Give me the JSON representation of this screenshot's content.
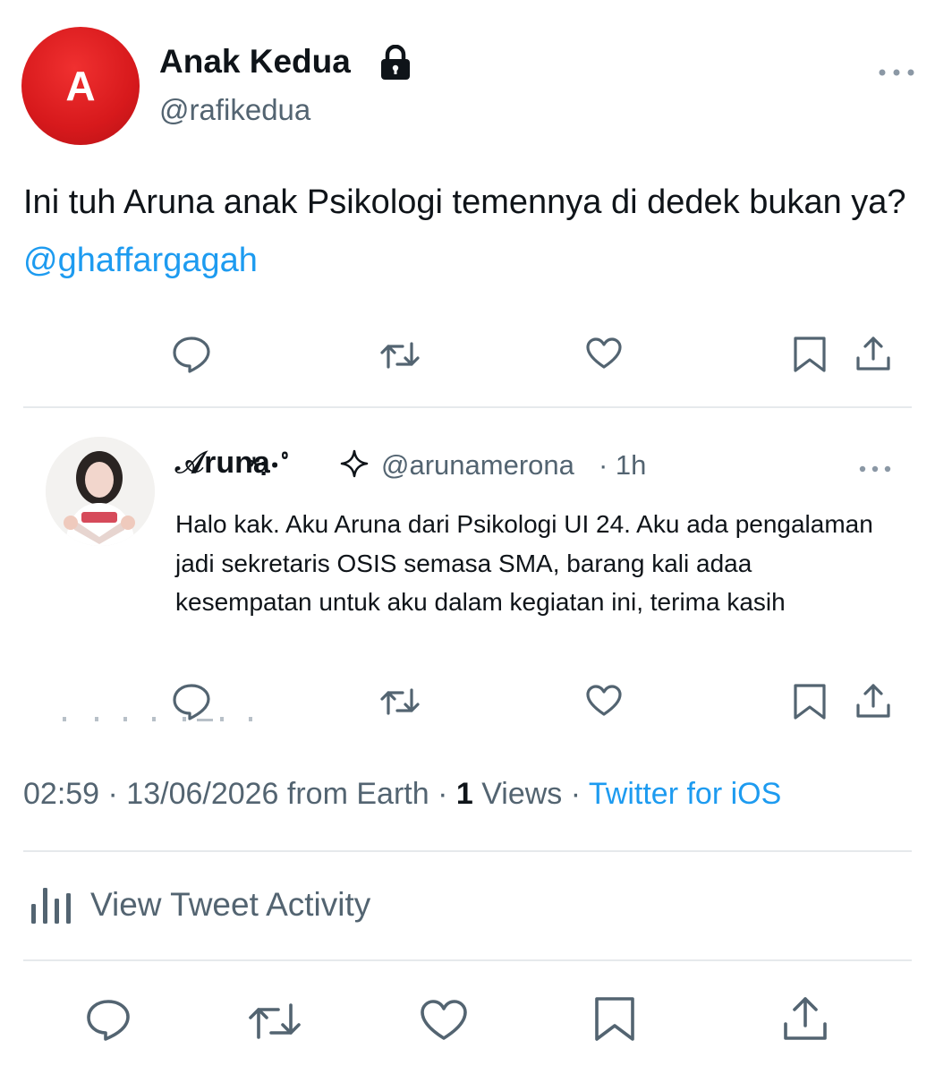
{
  "author": {
    "avatar_letter": "A",
    "avatar_color": "#d7191c",
    "display_name": "Anak Kedua",
    "handle": "@rafikedua",
    "protected_icon": "lock-icon"
  },
  "tweet": {
    "text_main": "Ini tuh Aruna anak Psikologi temennya di dedek bukan ya? ",
    "mention": "@ghaffargagah"
  },
  "actions": {
    "icons": [
      "reply-icon",
      "retweet-icon",
      "like-icon",
      "bookmark-icon",
      "share-icon"
    ]
  },
  "reply": {
    "name_script": "𝒜runa",
    "name_suffix": "*:･ﾟ",
    "badge_icon": "sparkle-icon",
    "handle": "@arunamerona",
    "time": "· 1h",
    "text": "Halo kak. Aku Aruna dari Psikologi UI 24. Aku ada pengalaman jadi sekretaris OSIS semasa SMA, barang kali adaa kesempatan untuk aku dalam kegiatan ini, terima kasih"
  },
  "meta": {
    "timestamp": "02:59 · 13/06/2026 from Earth · ",
    "views_count": "1",
    "views_label": " Views · ",
    "source": "Twitter for iOS"
  },
  "activity": {
    "label": "View Tweet Activity"
  },
  "colors": {
    "link": "#1d9bf0",
    "secondary": "#536471",
    "primary": "#0f1419",
    "divider": "#e6e9ec"
  }
}
